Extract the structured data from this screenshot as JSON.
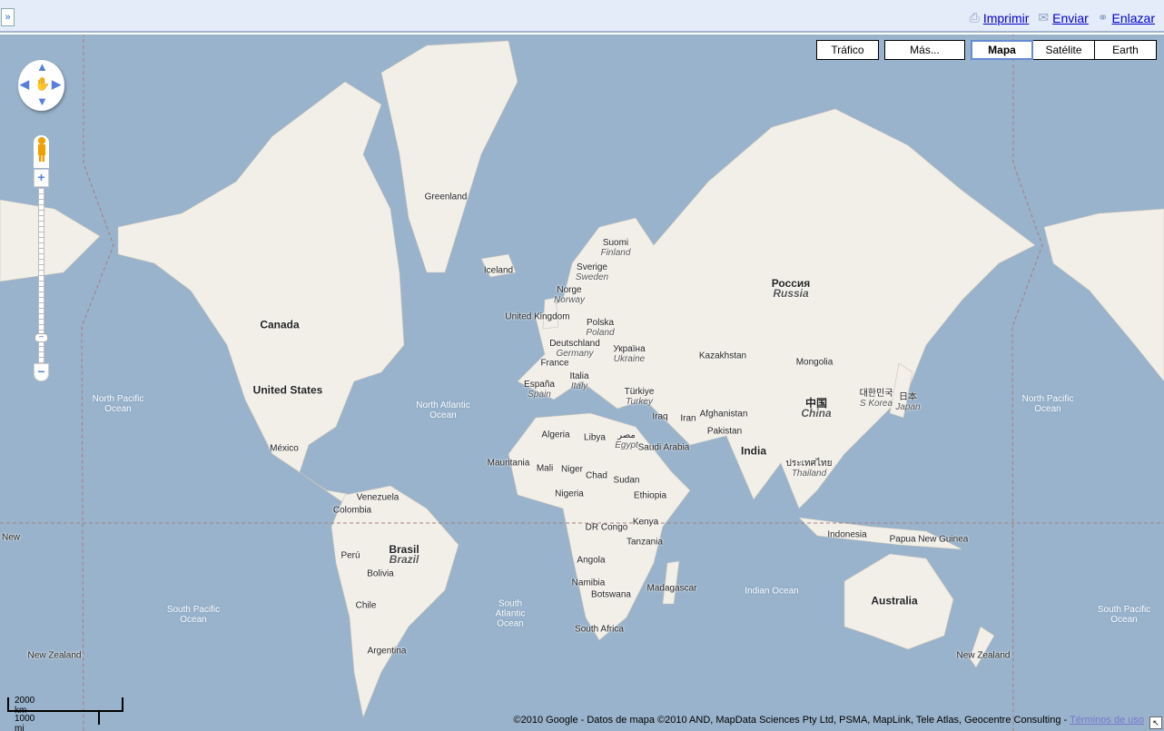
{
  "topbar": {
    "collapse": "»",
    "links": [
      {
        "icon": "printer-icon",
        "label": "Imprimir"
      },
      {
        "icon": "envelope-icon",
        "label": "Enviar"
      },
      {
        "icon": "link-icon",
        "label": "Enlazar"
      }
    ]
  },
  "maptypes": {
    "traffic": "Tráfico",
    "more": "Más...",
    "types": [
      "Mapa",
      "Satélite",
      "Earth"
    ],
    "selected": "Mapa"
  },
  "zoom": {
    "plus": "+",
    "minus": "−",
    "level_fraction": 0.18
  },
  "labels": [
    {
      "t": "Greenland"
    },
    {
      "t": "Iceland"
    },
    {
      "t": "Suomi",
      "s": "Finland"
    },
    {
      "t": "Sverige",
      "s": "Sweden"
    },
    {
      "t": "Norge",
      "s": "Norway"
    },
    {
      "t": "United Kingdom"
    },
    {
      "t": "Polska",
      "s": "Poland"
    },
    {
      "t": "Deutschland",
      "s": "Germany"
    },
    {
      "t": "Україна",
      "s": "Ukraine"
    },
    {
      "t": "France"
    },
    {
      "t": "Italia",
      "s": "Italy"
    },
    {
      "t": "España",
      "s": "Spain"
    },
    {
      "t": "Türkiye",
      "s": "Turkey"
    },
    {
      "t": "Россия",
      "s": "Russia",
      "big": true
    },
    {
      "t": "Kazakhstan"
    },
    {
      "t": "Mongolia"
    },
    {
      "t": "中国",
      "s": "China",
      "big": true
    },
    {
      "t": "대한민국",
      "s": "S Korea"
    },
    {
      "t": "日本",
      "s": "Japan"
    },
    {
      "t": "Afghanistan"
    },
    {
      "t": "Iran"
    },
    {
      "t": "Iraq"
    },
    {
      "t": "Pakistan"
    },
    {
      "t": "India",
      "big": true
    },
    {
      "t": "Saudi Arabia"
    },
    {
      "t": "مصر",
      "s": "Egypt"
    },
    {
      "t": "Libya"
    },
    {
      "t": "Algeria"
    },
    {
      "t": "Mauritania"
    },
    {
      "t": "Mali"
    },
    {
      "t": "Niger"
    },
    {
      "t": "Chad"
    },
    {
      "t": "Sudan"
    },
    {
      "t": "Nigeria"
    },
    {
      "t": "Ethiopia"
    },
    {
      "t": "DR Congo"
    },
    {
      "t": "Kenya"
    },
    {
      "t": "Tanzania"
    },
    {
      "t": "Angola"
    },
    {
      "t": "Namibia"
    },
    {
      "t": "Botswana"
    },
    {
      "t": "South Africa"
    },
    {
      "t": "Madagascar"
    },
    {
      "t": "ประเทศไทย",
      "s": "Thailand"
    },
    {
      "t": "Indonesia"
    },
    {
      "t": "Papua New Guinea"
    },
    {
      "t": "Australia",
      "big": true
    },
    {
      "t": "New Zealand"
    },
    {
      "t": "New Zealand"
    },
    {
      "t": "Canada",
      "big": true
    },
    {
      "t": "United States",
      "big": true
    },
    {
      "t": "México"
    },
    {
      "t": "Venezuela"
    },
    {
      "t": "Colombia"
    },
    {
      "t": "Perú"
    },
    {
      "t": "Brasil",
      "s": "Brazil",
      "big": true
    },
    {
      "t": "Bolivia"
    },
    {
      "t": "Chile"
    },
    {
      "t": "Argentina"
    },
    {
      "t": "New"
    },
    {
      "t": "North Pacific Ocean",
      "ocean": true
    },
    {
      "t": "North Pacific Ocean",
      "ocean": true
    },
    {
      "t": "North Atlantic Ocean",
      "ocean": true
    },
    {
      "t": "South Pacific Ocean",
      "ocean": true
    },
    {
      "t": "South Pacific Ocean",
      "ocean": true
    },
    {
      "t": "South Atlantic Ocean",
      "ocean": true
    },
    {
      "t": "Indian Ocean",
      "ocean": true
    }
  ],
  "scale": {
    "km": "2000 km",
    "mi": "1000 mi"
  },
  "attribution": {
    "text": "©2010 Google - Datos de mapa ©2010 AND, MapData Sciences Pty Ltd, PSMA, MapLink, Tele Atlas, Geocentre Consulting - ",
    "terms": "Términos de uso"
  },
  "colors": {
    "water": "#99b3cc",
    "land": "#f2efe9",
    "park": "#c5dea0",
    "link": "#0000cc"
  }
}
